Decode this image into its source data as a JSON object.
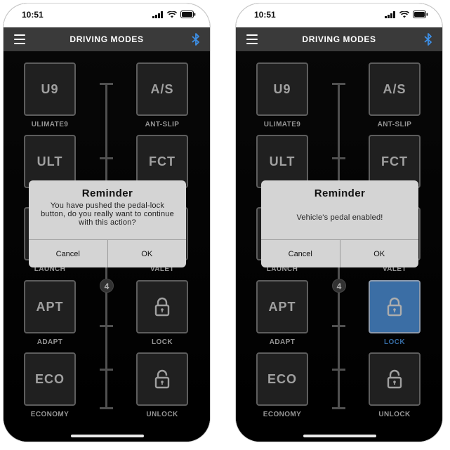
{
  "phones": [
    {
      "status_time": "10:51",
      "header_title": "DRIVING MODES",
      "slider_value": "4",
      "modes": {
        "u9": {
          "button": "U9",
          "label": "ULIMATE9"
        },
        "as": {
          "button": "A/S",
          "label": "ANT-SLIP"
        },
        "ult": {
          "button": "ULT"
        },
        "fct": {
          "button": "FCT"
        },
        "launch": {
          "label": "LAUNCH"
        },
        "valet": {
          "label": "VALET"
        },
        "apt": {
          "button": "APT",
          "label": "ADAPT"
        },
        "lock": {
          "icon": "lock-icon",
          "label": "LOCK"
        },
        "eco": {
          "button": "ECO",
          "label": "ECONOMY"
        },
        "unlock": {
          "icon": "unlock-icon",
          "label": "UNLOCK"
        }
      },
      "dialog": {
        "title": "Reminder",
        "message": "You have pushed the pedal-lock  button, do you really want to continue with this action?",
        "cancel_label": "Cancel",
        "ok_label": "OK"
      }
    },
    {
      "status_time": "10:51",
      "header_title": "DRIVING MODES",
      "slider_value": "4",
      "modes": {
        "u9": {
          "button": "U9",
          "label": "ULIMATE9"
        },
        "as": {
          "button": "A/S",
          "label": "ANT-SLIP"
        },
        "ult": {
          "button": "ULT"
        },
        "fct": {
          "button": "FCT"
        },
        "launch": {
          "label": "LAUNCH"
        },
        "valet": {
          "label": "VALET"
        },
        "apt": {
          "button": "APT",
          "label": "ADAPT"
        },
        "lock": {
          "icon": "lock-icon",
          "label": "LOCK",
          "active": true
        },
        "eco": {
          "button": "ECO",
          "label": "ECONOMY"
        },
        "unlock": {
          "icon": "unlock-icon",
          "label": "UNLOCK"
        }
      },
      "dialog": {
        "title": "Reminder",
        "message": "Vehicle's pedal enabled!",
        "cancel_label": "Cancel",
        "ok_label": "OK"
      }
    }
  ],
  "colors": {
    "accent_blue": "#57a3f3",
    "bluetooth_blue": "#3d8fe6",
    "header_bg": "#3a3a3a",
    "button_bg": "#303030",
    "dialog_bg": "#d4d4d4"
  }
}
